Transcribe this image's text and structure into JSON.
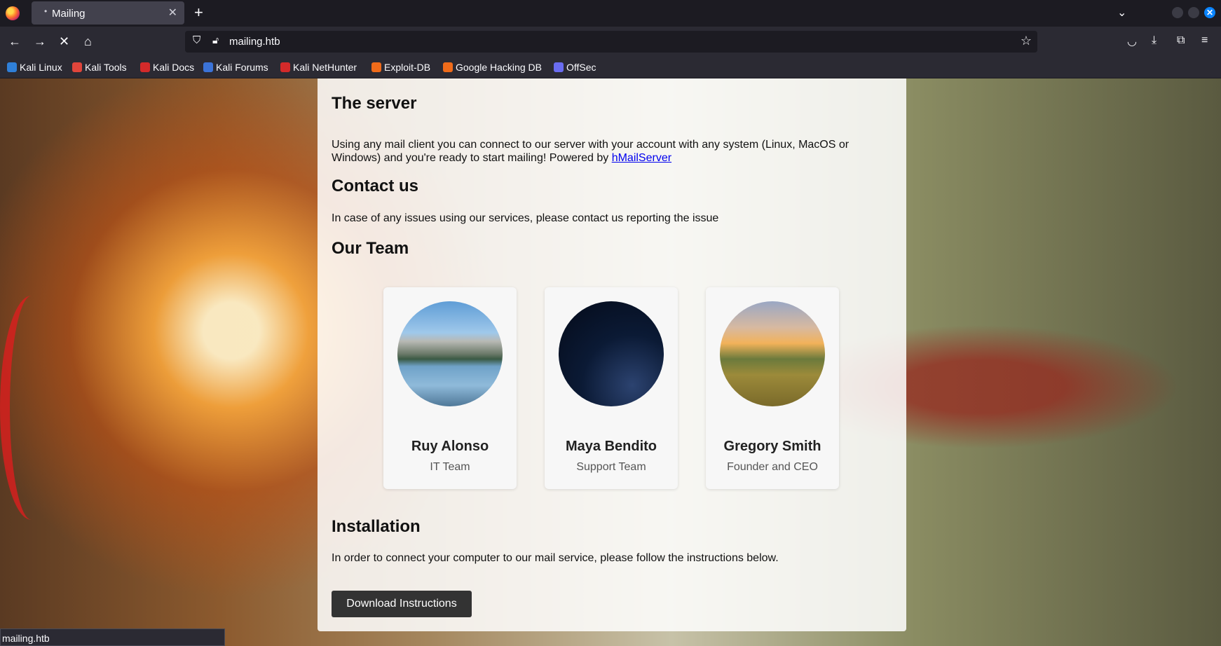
{
  "browser": {
    "tab_title": "Mailing",
    "tab_dot": "•",
    "url": "mailing.htb",
    "status_url": "mailing.htb",
    "bookmarks": [
      {
        "label": "Kali Linux",
        "color": "#2f7fd8"
      },
      {
        "label": "Kali Tools",
        "color": "#e0453b"
      },
      {
        "label": "Kali Docs",
        "color": "#d32a2a"
      },
      {
        "label": "Kali Forums",
        "color": "#3b73d8"
      },
      {
        "label": "Kali NetHunter",
        "color": "#d32a2a"
      },
      {
        "label": "Exploit-DB",
        "color": "#ef6b1a"
      },
      {
        "label": "Google Hacking DB",
        "color": "#ef6b1a"
      },
      {
        "label": "OffSec",
        "color": "#6a6cf0"
      }
    ]
  },
  "sections": {
    "server_title": "The server",
    "server_text": "Using any mail client you can connect to our server with your account with any system (Linux, MacOS or Windows) and you're ready to start mailing! Powered by",
    "server_link": "hMailServer",
    "contact_title": "Contact us",
    "contact_text": "In case of any issues using our services, please contact us reporting the issue",
    "team_title": "Our Team",
    "install_title": "Installation",
    "install_text": "In order to connect your computer to our mail service, please follow the instructions below.",
    "download_label": "Download Instructions"
  },
  "team": [
    {
      "name": "Ruy Alonso",
      "role": "IT Team",
      "photo": "mountain-lake"
    },
    {
      "name": "Maya Bendito",
      "role": "Support Team",
      "photo": "night-sky"
    },
    {
      "name": "Gregory Smith",
      "role": "Founder and CEO",
      "photo": "sunset-hills"
    }
  ]
}
